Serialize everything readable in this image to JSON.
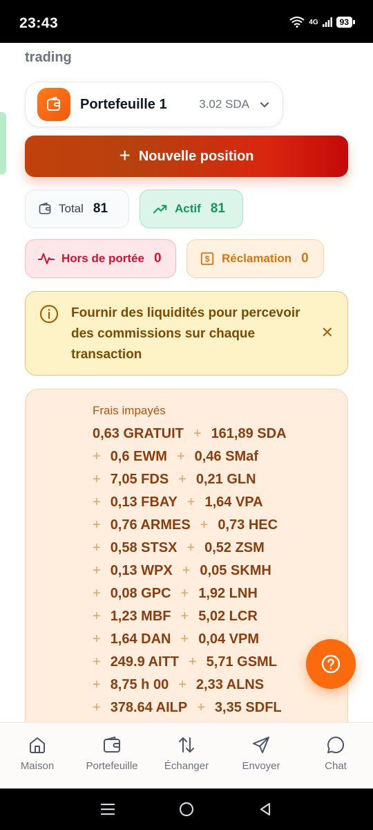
{
  "status_bar": {
    "time": "23:43",
    "network": "4G",
    "battery": "93"
  },
  "header": {
    "subtitle": "trading"
  },
  "wallet": {
    "name": "Portefeuille 1",
    "balance": "3.02 SDA",
    "icon": "wallet-icon"
  },
  "actions": {
    "new_position_label": "Nouvelle position"
  },
  "stats": {
    "total": {
      "label": "Total",
      "count": "81"
    },
    "actif": {
      "label": "Actif",
      "count": "81"
    },
    "out_of_range": {
      "label": "Hors de portée",
      "count": "0"
    },
    "claim": {
      "label": "Réclamation",
      "count": "0"
    }
  },
  "info_banner": {
    "text": "Fournir des liquidités pour percevoir des commissions sur chaque transaction",
    "close_icon": "close-icon"
  },
  "fees": {
    "title": "Frais impayés",
    "rows": [
      {
        "a": "0,63 GRATUIT",
        "b": "161,89 SDA"
      },
      {
        "a": "0,6 EWM",
        "b": "0,46 SMaf"
      },
      {
        "a": "7,05 FDS",
        "b": "0,21 GLN"
      },
      {
        "a": "0,13 FBAY",
        "b": "1,64 VPA"
      },
      {
        "a": "0,76 ARMES",
        "b": "0,73 HEC"
      },
      {
        "a": "0,58 STSX",
        "b": "0,52 ZSM"
      },
      {
        "a": "0,13 WPX",
        "b": "0,05 SKMH"
      },
      {
        "a": "0,08 GPC",
        "b": "1,92 LNH"
      },
      {
        "a": "1,23 MBF",
        "b": "5,02 LCR"
      },
      {
        "a": "1,64 DAN",
        "b": "0,04 VPM"
      },
      {
        "a": "249.9 AITT",
        "b": "5,71 GSML"
      },
      {
        "a": "8,75 h 00",
        "b": "2,33 ALNS"
      },
      {
        "a": "378.64 AILP",
        "b": "3,35 SDFL"
      }
    ]
  },
  "bottom_nav": {
    "items": [
      {
        "label": "Maison",
        "icon": "home-icon"
      },
      {
        "label": "Portefeuille",
        "icon": "wallet-icon"
      },
      {
        "label": "Échanger",
        "icon": "swap-icon"
      },
      {
        "label": "Envoyer",
        "icon": "send-icon"
      },
      {
        "label": "Chat",
        "icon": "chat-icon"
      }
    ]
  },
  "colors": {
    "brand_orange": "#fb6a0c",
    "button_gradient_start": "#c2410c",
    "button_gradient_end": "#c40a0a",
    "active_green": "#15965b",
    "danger_red": "#d2122e"
  }
}
